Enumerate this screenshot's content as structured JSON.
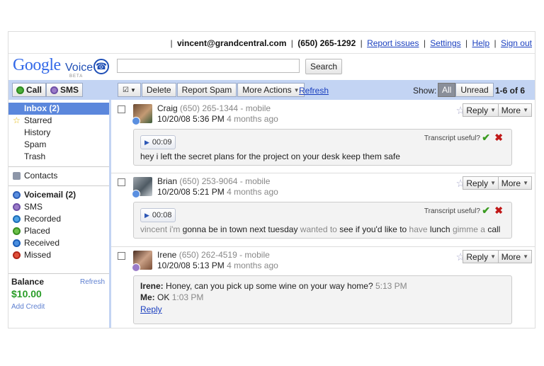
{
  "header": {
    "email": "vincent@grandcentral.com",
    "phone": "(650) 265-1292",
    "links": [
      "Report issues",
      "Settings",
      "Help",
      "Sign out"
    ]
  },
  "logo": {
    "google": "Google",
    "voice": "Voice",
    "beta": "BETA"
  },
  "search": {
    "value": "",
    "button": "Search"
  },
  "actions": {
    "call": "Call",
    "sms": "SMS",
    "delete": "Delete",
    "report_spam": "Report Spam",
    "more_actions": "More Actions",
    "refresh": "Refresh",
    "show": "Show:",
    "all": "All",
    "unread": "Unread",
    "count": "1-6 of 6"
  },
  "sidebar": {
    "folders": [
      "Inbox (2)",
      "Starred",
      "History",
      "Spam",
      "Trash"
    ],
    "contacts": "Contacts",
    "types": [
      "Voicemail (2)",
      "SMS",
      "Recorded",
      "Placed",
      "Received",
      "Missed"
    ],
    "balance_label": "Balance",
    "balance_refresh": "Refresh",
    "balance_amount": "$10.00",
    "add_credit": "Add Credit"
  },
  "messages": [
    {
      "name": "Craig",
      "number": "(650) 265-1344 - mobile",
      "datetime": "10/20/08 5:36 PM",
      "ago": "4 months ago",
      "duration": "00:09",
      "transcript_label": "Transcript useful?",
      "transcript": "hey i left the secret plans for the project on your desk keep them safe"
    },
    {
      "name": "Brian",
      "number": "(650) 253-9064 - mobile",
      "datetime": "10/20/08 5:21 PM",
      "ago": "4 months ago",
      "duration": "00:08",
      "transcript_label": "Transcript useful?",
      "transcript_parts": [
        "vincent i'm",
        "gonna be in town next tuesday",
        "wanted to",
        "see if you'd like to",
        "have",
        "lunch",
        "gimme a",
        "call"
      ]
    },
    {
      "name": "Irene",
      "number": "(650) 262-4519 - mobile",
      "datetime": "10/20/08 5:13 PM",
      "ago": "4 months ago",
      "sms": [
        {
          "who": "Irene:",
          "text": "Honey, can you pick up some wine on your way home?",
          "time": "5:13 PM"
        },
        {
          "who": "Me:",
          "text": "OK",
          "time": "1:03 PM"
        }
      ],
      "reply_link": "Reply"
    }
  ],
  "row_buttons": {
    "reply": "Reply",
    "more": "More"
  },
  "colors": {
    "toolbar": "#c3d4f3",
    "selected": "#5b87dc",
    "balance": "#2a9d28",
    "link": "#1a3fbf"
  }
}
